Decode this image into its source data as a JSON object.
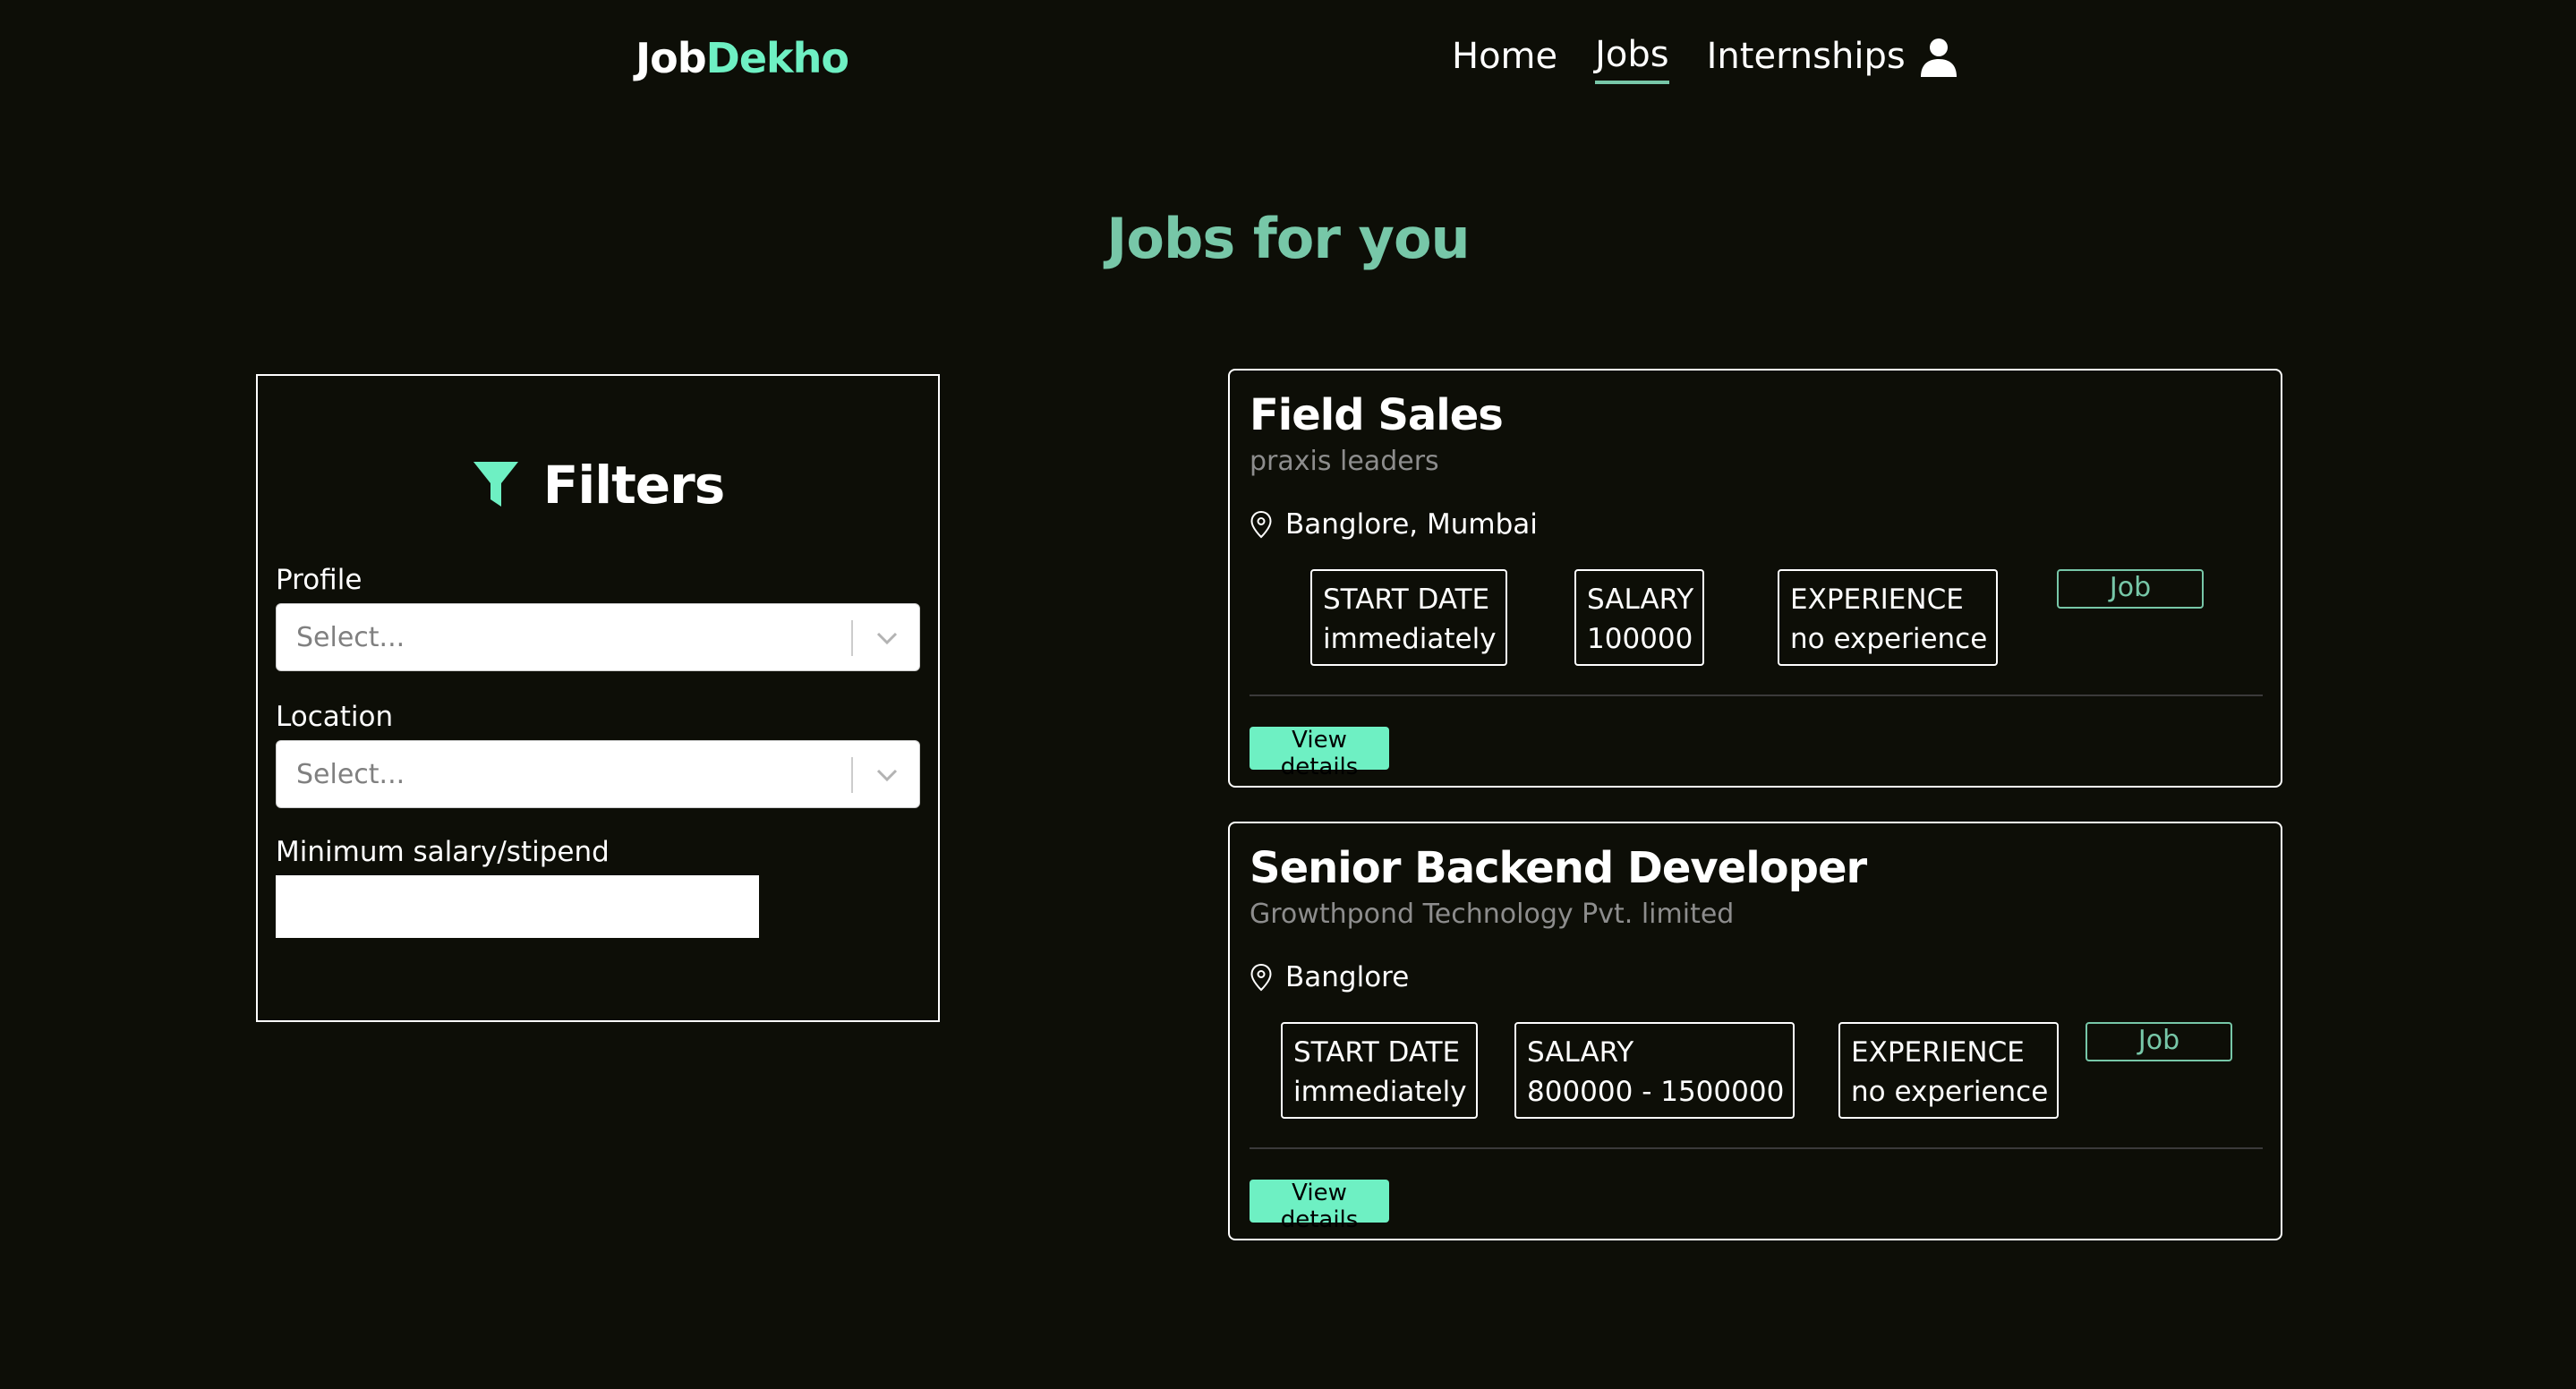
{
  "nav": {
    "logo_part1": "Job",
    "logo_part2": "Dekho",
    "links": [
      {
        "label": "Home",
        "active": false
      },
      {
        "label": "Jobs",
        "active": true
      },
      {
        "label": "Internships",
        "active": false
      }
    ],
    "user_icon": "user-icon"
  },
  "page": {
    "title": "Jobs for you"
  },
  "filters": {
    "title": "Filters",
    "icon": "filter-icon",
    "profile": {
      "label": "Profile",
      "placeholder": "Select..."
    },
    "location": {
      "label": "Location",
      "placeholder": "Select..."
    },
    "salary": {
      "label": "Minimum salary/stipend",
      "value": ""
    }
  },
  "jobs": [
    {
      "title": "Field Sales",
      "company": "praxis leaders",
      "location": "Banglore, Mumbai",
      "start_label": "START DATE",
      "start_value": "immediately",
      "salary_label": "SALARY",
      "salary_value": "100000",
      "experience_label": "EXPERIENCE",
      "experience_value": "no experience",
      "type": "Job",
      "view_label": "View details"
    },
    {
      "title": "Senior Backend Developer",
      "company": "Growthpond Technology Pvt. limited",
      "location": "Banglore",
      "start_label": "START DATE",
      "start_value": "immediately",
      "salary_label": "SALARY",
      "salary_value": "800000 - 1500000",
      "experience_label": "EXPERIENCE",
      "experience_value": "no experience",
      "type": "Job",
      "view_label": "View details"
    }
  ],
  "colors": {
    "background": "#0d0e07",
    "accent": "#6ef0c3",
    "heading": "#77c7a8",
    "muted": "#8d8d8d"
  }
}
